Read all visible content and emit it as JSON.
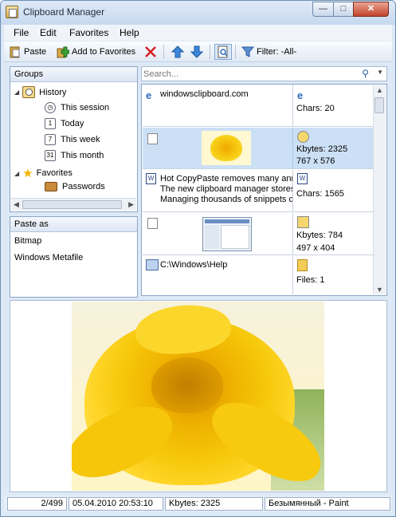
{
  "window": {
    "title": "Clipboard Manager",
    "controls": {
      "minimize": "—",
      "maximize": "□",
      "close": "✕"
    }
  },
  "menu": [
    "File",
    "Edit",
    "Favorites",
    "Help"
  ],
  "toolbar": {
    "paste": "Paste",
    "add_favorites": "Add to Favorites",
    "filter": "Filter: -All-"
  },
  "groups": {
    "header": "Groups",
    "items": {
      "history": "History",
      "this_session": "This session",
      "today": "Today",
      "this_week": "This week",
      "this_month": "This month",
      "favorites": "Favorites",
      "passwords": "Passwords"
    },
    "cal_today": "1",
    "cal_week": "7",
    "cal_month": "31"
  },
  "paste_as": {
    "header": "Paste as",
    "items": [
      "Bitmap",
      "Windows Metafile"
    ]
  },
  "search": {
    "placeholder": "Search..."
  },
  "list": [
    {
      "text": "windowsclipboard.com",
      "info1": "Chars: 20",
      "info2": ""
    },
    {
      "text": "",
      "info1": "Kbytes: 2325",
      "info2": "767 x 576",
      "selected": true
    },
    {
      "lines": [
        "Hot CopyPaste removes many anr",
        "The new clipboard manager stores",
        "Managing thousands of snippets c"
      ],
      "info1": "Chars: 1565",
      "info2": ""
    },
    {
      "text": "",
      "info1": "Kbytes: 784",
      "info2": "497 x 404"
    },
    {
      "text": "C:\\Windows\\Help",
      "info1": "Files: 1",
      "info2": ""
    }
  ],
  "status": {
    "position": "2/499",
    "datetime": "05.04.2010 20:53:10",
    "size": "Kbytes: 2325",
    "source": "Безымянный - Paint"
  },
  "colors": {
    "accent": "#cce0f5",
    "flower": "#f6c400",
    "titlebar": "#c6d9ef"
  }
}
